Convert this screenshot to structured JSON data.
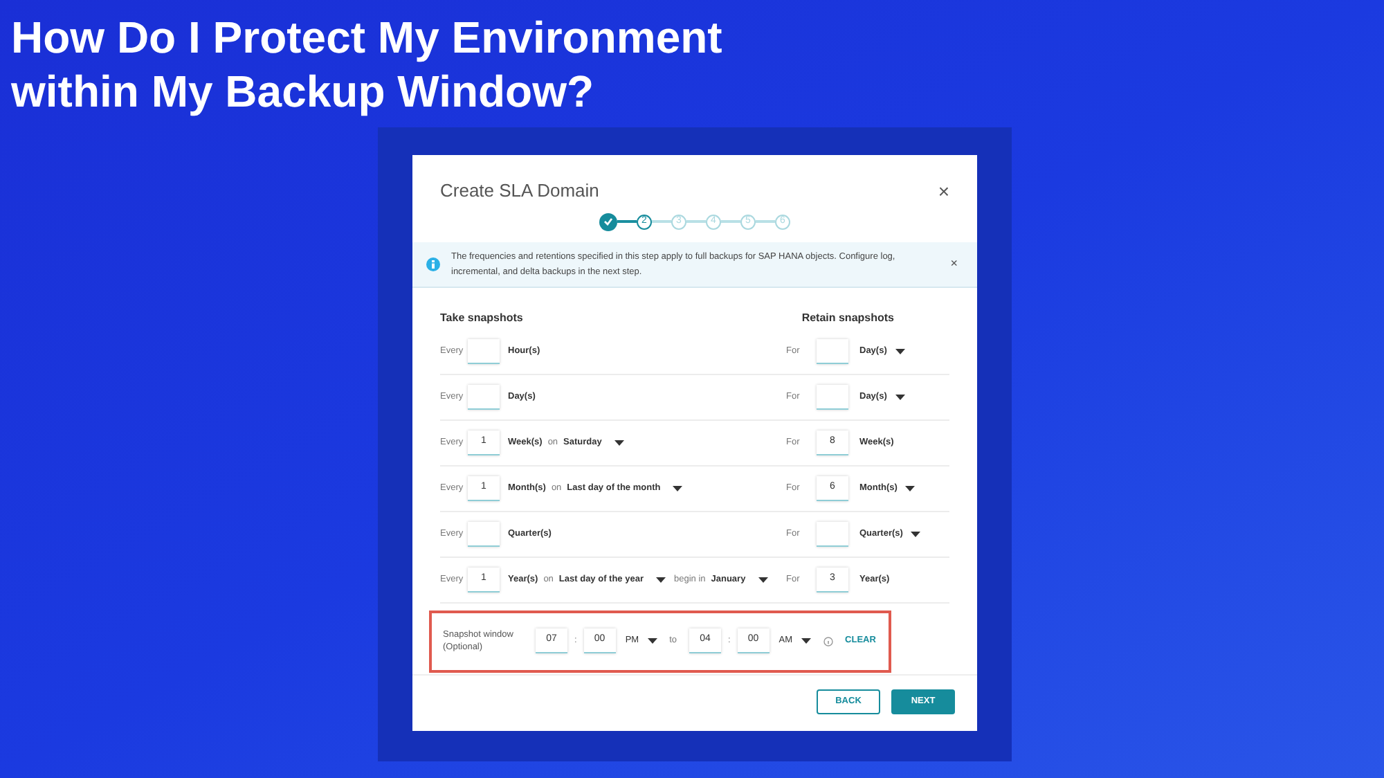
{
  "slide_title": "How Do I Protect My Environment within My Backup Window?",
  "dialog": {
    "title": "Create SLA Domain",
    "close": "×",
    "steps": [
      {
        "completed": true,
        "selected": false
      },
      {
        "label": "2",
        "completed": false,
        "selected": true
      },
      {
        "label": "3",
        "completed": false,
        "selected": false
      },
      {
        "label": "4",
        "completed": false,
        "selected": false
      },
      {
        "label": "5",
        "completed": false,
        "selected": false
      },
      {
        "label": "6",
        "completed": false,
        "selected": false
      }
    ],
    "info_banner": {
      "text": "The frequencies and retentions specified in this step apply to full backups for SAP HANA objects. Configure log, incremental, and delta backups in the next step.",
      "close": "×"
    },
    "take_heading": "Take snapshots",
    "retain_heading": "Retain snapshots",
    "rows": [
      {
        "label": "Every",
        "unit": "Hour(s)",
        "retain": {
          "label": "For",
          "unit": "Day(s)",
          "dropdown": true
        }
      },
      {
        "label": "Every",
        "unit": "Day(s)",
        "retain": {
          "label": "For",
          "unit": "Day(s)",
          "dropdown": true
        }
      },
      {
        "label": "Every",
        "value": "1",
        "unit": "Week(s)",
        "on": {
          "label": "on",
          "value": "Saturday"
        },
        "retain": {
          "label": "For",
          "value": "8",
          "unit": "Week(s)",
          "dropdown": false
        }
      },
      {
        "label": "Every",
        "value": "1",
        "unit": "Month(s)",
        "on": {
          "label": "on",
          "value": "Last day of the month"
        },
        "retain": {
          "label": "For",
          "value": "6",
          "unit": "Month(s)",
          "dropdown": true
        }
      },
      {
        "label": "Every",
        "unit": "Quarter(s)",
        "retain": {
          "label": "For",
          "unit": "Quarter(s)",
          "dropdown": true
        }
      },
      {
        "label": "Every",
        "value": "1",
        "unit": "Year(s)",
        "on": {
          "label": "on",
          "value": "Last day of the year"
        },
        "begin": {
          "label": "begin in",
          "value": "January"
        },
        "retain": {
          "label": "For",
          "value": "3",
          "unit": "Year(s)",
          "dropdown": false
        }
      }
    ],
    "snapshot_window": {
      "label": "Snapshot window",
      "sublabel": "(Optional)",
      "highlighted": true,
      "start_hour": "07",
      "start_colon": ":",
      "start_minute": "00",
      "start_period": "PM",
      "separator": "to",
      "end_hour": "04",
      "end_colon": ":",
      "end_minute": "00",
      "end_period": "AM",
      "clear": "CLEAR"
    },
    "buttons": {
      "back": "BACK",
      "next": "NEXT"
    }
  }
}
